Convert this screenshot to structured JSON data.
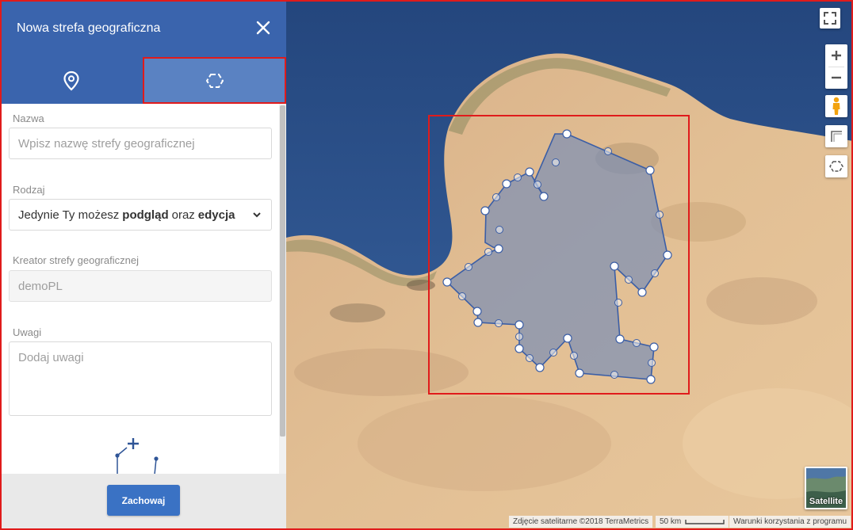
{
  "panel": {
    "title": "Nowa strefa geograficzna",
    "close_icon": "close-icon",
    "tabs": [
      {
        "icon": "map-pin-icon",
        "selected": false
      },
      {
        "icon": "polygon-icon",
        "selected": true
      }
    ]
  },
  "form": {
    "name": {
      "label": "Nazwa",
      "placeholder": "Wpisz nazwę strefy geograficznej"
    },
    "kind": {
      "label": "Rodzaj",
      "value_prefix": "Jedynie Ty możesz",
      "value_bold1": "podgląd",
      "value_mid": "oraz",
      "value_bold2": "edycja"
    },
    "creator": {
      "label": "Kreator strefy geograficznej",
      "value": "demoPL"
    },
    "notes": {
      "label": "Uwagi",
      "placeholder": "Dodaj uwagi"
    }
  },
  "footer": {
    "save_label": "Zachowaj"
  },
  "map": {
    "map_type_label": "Satellite",
    "attribution": "Zdjęcie satelitarne ©2018 TerraMetrics",
    "scale_label": "50 km",
    "terms": "Warunki korzystania z programu",
    "controls": [
      "fullscreen-icon",
      "zoom-in-icon",
      "zoom-out-icon",
      "pegman-icon",
      "rectangle-tool-icon",
      "polygon-tool-icon"
    ]
  },
  "colors": {
    "header": "#3a64ad",
    "tab_selected": "#5a82c2",
    "highlight": "#e01b1b",
    "save_button": "#3a72c4",
    "sea": "#2c4f86",
    "desert": "#d9b48a",
    "polygon_stroke": "#3b5ea6"
  }
}
